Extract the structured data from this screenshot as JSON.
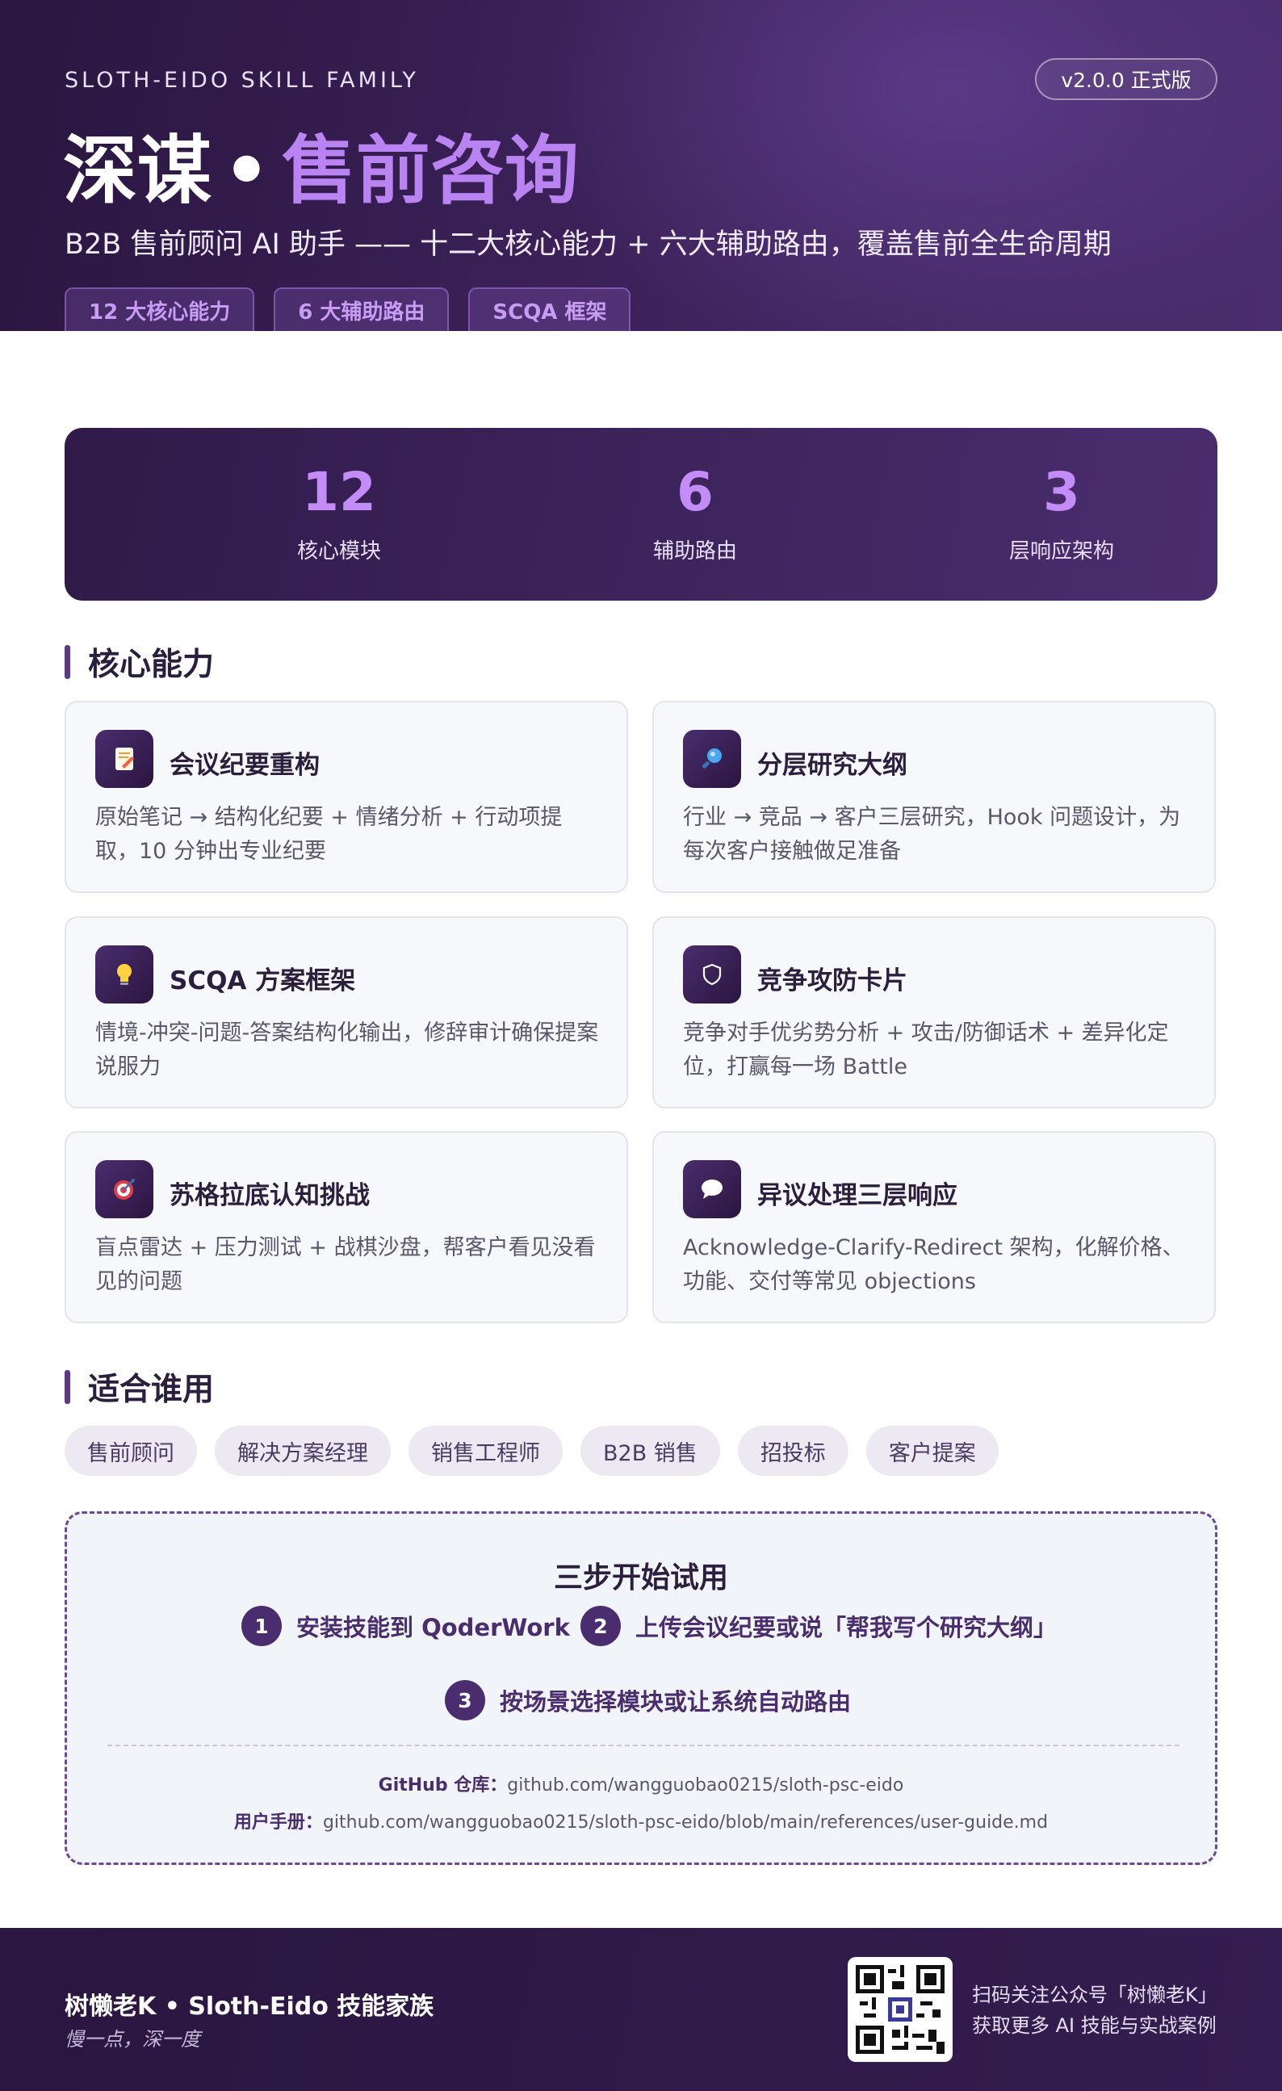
{
  "header": {
    "family": "SLOTH-EIDO SKILL FAMILY",
    "version": "v2.0.0 正式版",
    "title_main": "深谋",
    "title_sep": "•",
    "title_accent": "售前咨询",
    "subtitle": "B2B 售前顾问 AI 助手 —— 十二大核心能力 + 六大辅助路由，覆盖售前全生命周期",
    "tags": [
      "12 大核心能力",
      "6 大辅助路由",
      "SCQA 框架"
    ]
  },
  "stats": [
    {
      "value": "12",
      "label": "核心模块"
    },
    {
      "value": "6",
      "label": "辅助路由"
    },
    {
      "value": "3",
      "label": "层响应架构"
    }
  ],
  "sections": {
    "core": "核心能力",
    "audience": "适合谁用"
  },
  "cards": [
    {
      "icon": "memo-icon",
      "title": "会议纪要重构",
      "desc": "原始笔记 → 结构化纪要 + 情绪分析 + 行动项提取，10 分钟出专业纪要"
    },
    {
      "icon": "magnifier-icon",
      "title": "分层研究大纲",
      "desc": "行业 → 竞品 → 客户三层研究，Hook 问题设计，为每次客户接触做足准备"
    },
    {
      "icon": "lightbulb-icon",
      "title": "SCQA 方案框架",
      "desc": "情境-冲突-问题-答案结构化输出，修辞审计确保提案说服力"
    },
    {
      "icon": "shield-icon",
      "title": "竞争攻防卡片",
      "desc": "竞争对手优劣势分析 + 攻击/防御话术 + 差异化定位，打赢每一场 Battle"
    },
    {
      "icon": "target-icon",
      "title": "苏格拉底认知挑战",
      "desc": "盲点雷达 + 压力测试 + 战棋沙盘，帮客户看见没看见的问题"
    },
    {
      "icon": "speech-bubble-icon",
      "title": "异议处理三层响应",
      "desc": "Acknowledge-Clarify-Redirect 架构，化解价格、功能、交付等常见 objections"
    }
  ],
  "audience": [
    "售前顾问",
    "解决方案经理",
    "销售工程师",
    "B2B 销售",
    "招投标",
    "客户提案"
  ],
  "trial": {
    "title": "三步开始试用",
    "steps": [
      {
        "num": "1",
        "text": "安装技能到 QoderWork"
      },
      {
        "num": "2",
        "text": "上传会议纪要或说「帮我写个研究大纲」"
      },
      {
        "num": "3",
        "text": "按场景选择模块或让系统自动路由"
      }
    ],
    "github_label": "GitHub 仓库：",
    "github_url": "github.com/wangguobao0215/sloth-psc-eido",
    "manual_label": "用户手册：",
    "manual_url": "github.com/wangguobao0215/sloth-psc-eido/blob/main/references/user-guide.md"
  },
  "footer": {
    "brand": "树懒老K • Sloth-Eido 技能家族",
    "motto": "慢一点，深一度",
    "qr_line1": "扫码关注公众号「树懒老K」",
    "qr_line2": "获取更多 AI 技能与实战案例"
  }
}
